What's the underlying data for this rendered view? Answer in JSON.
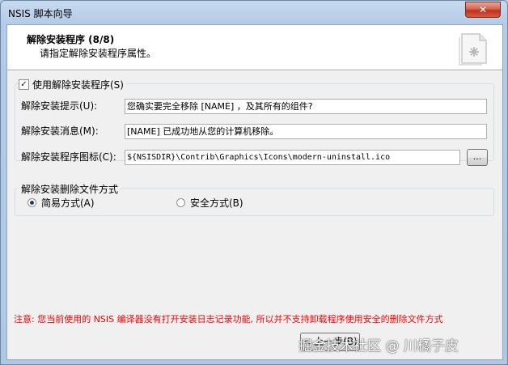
{
  "window": {
    "title": "NSIS 脚本向导",
    "close_label": "✕"
  },
  "header": {
    "title": "解除安装程序 (8/8)",
    "subtitle": "请指定解除安装程序属性。",
    "icon": "installer-document-icon"
  },
  "uninstaller_group": {
    "checkbox_label": "使用解除安装程序(S)",
    "checked": true,
    "check_mark": "✓",
    "prompt_label": "解除安装提示(U):",
    "prompt_value": "您确实要完全移除 [NAME] ，及其所有的组件?",
    "message_label": "解除安装消息(M):",
    "message_value": "[NAME] 已成功地从您的计算机移除。",
    "icon_label": "解除安装程序图标(C):",
    "icon_value": "${NSISDIR}\\Contrib\\Graphics\\Icons\\modern-uninstall.ico",
    "browse_label": "..."
  },
  "delete_mode_group": {
    "legend": "解除安装删除文件方式",
    "options": [
      {
        "label": "简易方式(A)",
        "selected": true
      },
      {
        "label": "安全方式(B)",
        "selected": false
      }
    ]
  },
  "note": "注意: 您当前使用的 NSIS 编译器没有打开安装日志记录功能, 所以并不支持卸载程序使用安全的删除文件方式",
  "nav": {
    "back_label": "< 上一步(B)"
  },
  "watermark": "掘金技术社区 @ 川橘子皮",
  "colors": {
    "note": "#ff0000",
    "close": "#c1301c"
  }
}
